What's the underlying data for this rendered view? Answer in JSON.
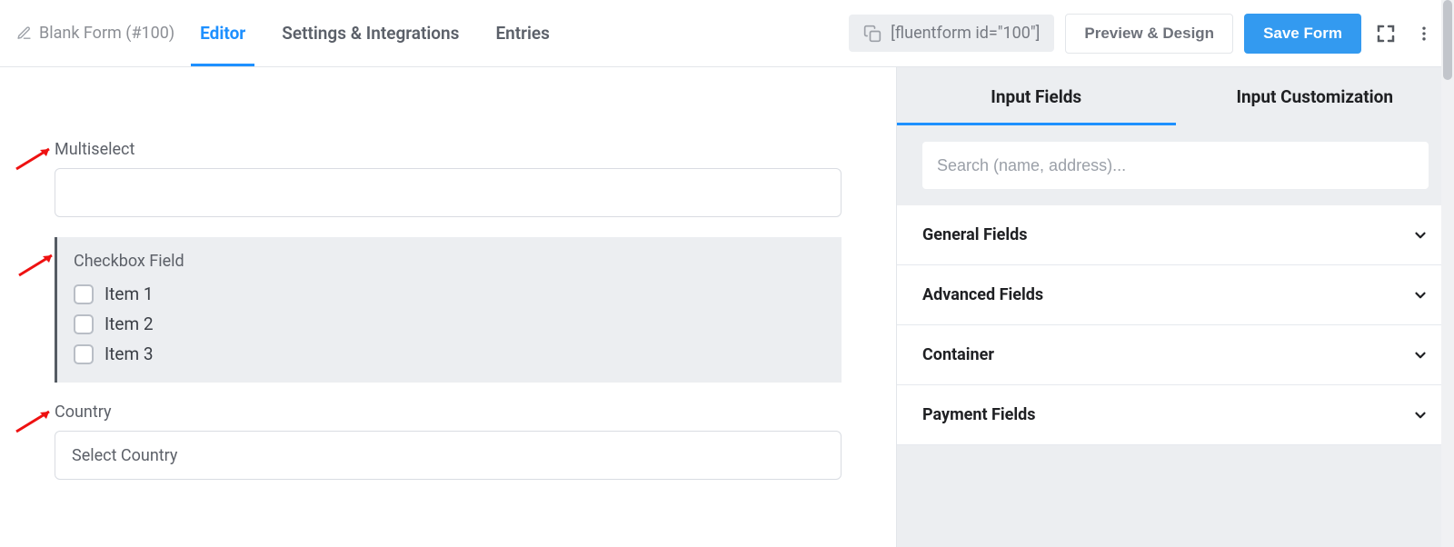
{
  "topbar": {
    "form_title": "Blank Form (#100)",
    "tabs": [
      {
        "label": "Editor",
        "active": true
      },
      {
        "label": "Settings & Integrations",
        "active": false
      },
      {
        "label": "Entries",
        "active": false
      }
    ],
    "shortcode": "[fluentform id=\"100\"]",
    "preview_label": "Preview & Design",
    "save_label": "Save Form"
  },
  "canvas": {
    "multiselect": {
      "label": "Multiselect",
      "value": ""
    },
    "checkbox": {
      "label": "Checkbox Field",
      "items": [
        "Item 1",
        "Item 2",
        "Item 3"
      ]
    },
    "country": {
      "label": "Country",
      "placeholder": "Select Country"
    }
  },
  "sidepanel": {
    "tabs": [
      "Input Fields",
      "Input Customization"
    ],
    "search_placeholder": "Search (name, address)...",
    "groups": [
      "General Fields",
      "Advanced Fields",
      "Container",
      "Payment Fields"
    ]
  }
}
